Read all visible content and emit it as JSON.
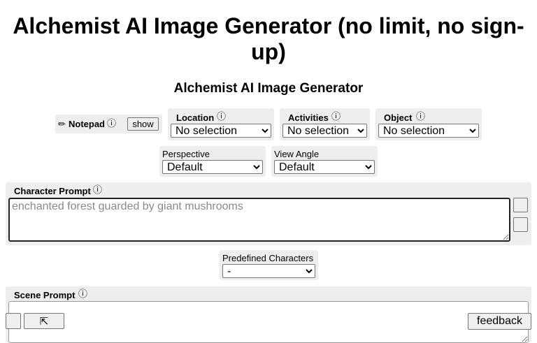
{
  "page": {
    "title": "Alchemist AI Image Generator (no limit, no sign-up)",
    "subtitle": "Alchemist AI Image Generator"
  },
  "notepad": {
    "icon": "✏",
    "label": "Notepad",
    "info": "ⓘ",
    "show_button": "show"
  },
  "selectors": {
    "location": {
      "icon": "",
      "label": "Location",
      "info": "ⓘ",
      "value": "No selection"
    },
    "activities": {
      "icon": "",
      "label": "Activities",
      "info": "ⓘ",
      "value": "No selection"
    },
    "object": {
      "icon": "",
      "label": "Object",
      "info": "ⓘ",
      "value": "No selection"
    },
    "perspective": {
      "label": "Perspective",
      "value": "Default"
    },
    "view_angle": {
      "label": "View Angle",
      "value": "Default"
    }
  },
  "character_prompt": {
    "icon": "",
    "label": "Character Prompt",
    "info": "ⓘ",
    "placeholder": "enchanted forest guarded by giant mushrooms",
    "side_button_1": "",
    "side_button_2": ""
  },
  "predefined_characters": {
    "label": "Predefined Characters",
    "value": "-"
  },
  "scene_prompt": {
    "icon": "",
    "label": "Scene Prompt",
    "info": "ⓘ",
    "placeholder": ""
  },
  "bottom_bar": {
    "left_button": "",
    "scroll_top_button": "⇱",
    "feedback_icon": "",
    "feedback_label": "feedback"
  }
}
